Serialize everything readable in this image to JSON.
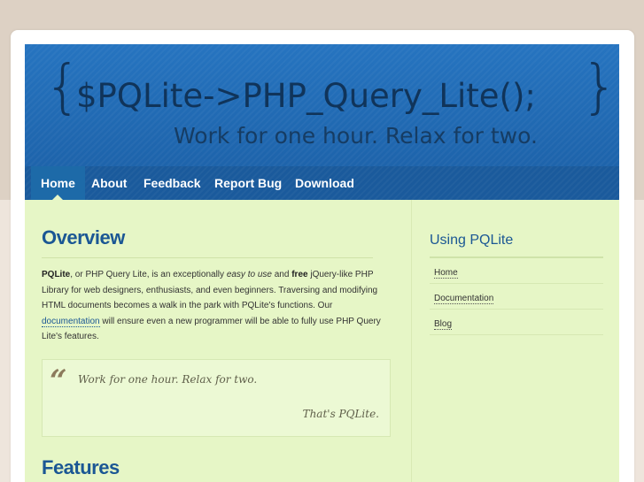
{
  "header": {
    "logo_left_brace": "{",
    "logo_text": "$PQLite->PHP_Query_Lite();",
    "logo_right_brace": "}",
    "tagline": "Work for one hour. Relax for two."
  },
  "nav": {
    "items": [
      {
        "label": "Home",
        "active": true
      },
      {
        "label": "About"
      },
      {
        "label": "Feedback"
      },
      {
        "label": "Report Bug"
      },
      {
        "label": "Download"
      }
    ]
  },
  "main": {
    "overview_title": "Overview",
    "paragraph": {
      "p1": "PQLite",
      "p2": ", or PHP Query Lite, is an exceptionally ",
      "p3": "easy to use",
      "p4": " and ",
      "p5": "free",
      "p6": " jQuery-like PHP Library for web designers, enthusiasts, and even beginners. Traversing and modifying HTML documents becomes a walk in the park with PQLite's functions. Our ",
      "link": "documentation",
      "p7": " will ensure even a new programmer will be able to fully use PHP Query Lite's features."
    },
    "quote": {
      "mark": "“",
      "text": "Work for one hour. Relax for two.",
      "cite": "That's PQLite."
    },
    "features_title": "Features"
  },
  "sidebar": {
    "title": "Using PQLite",
    "items": [
      {
        "label": "Home"
      },
      {
        "label": "Documentation"
      },
      {
        "label": "Blog"
      }
    ]
  }
}
